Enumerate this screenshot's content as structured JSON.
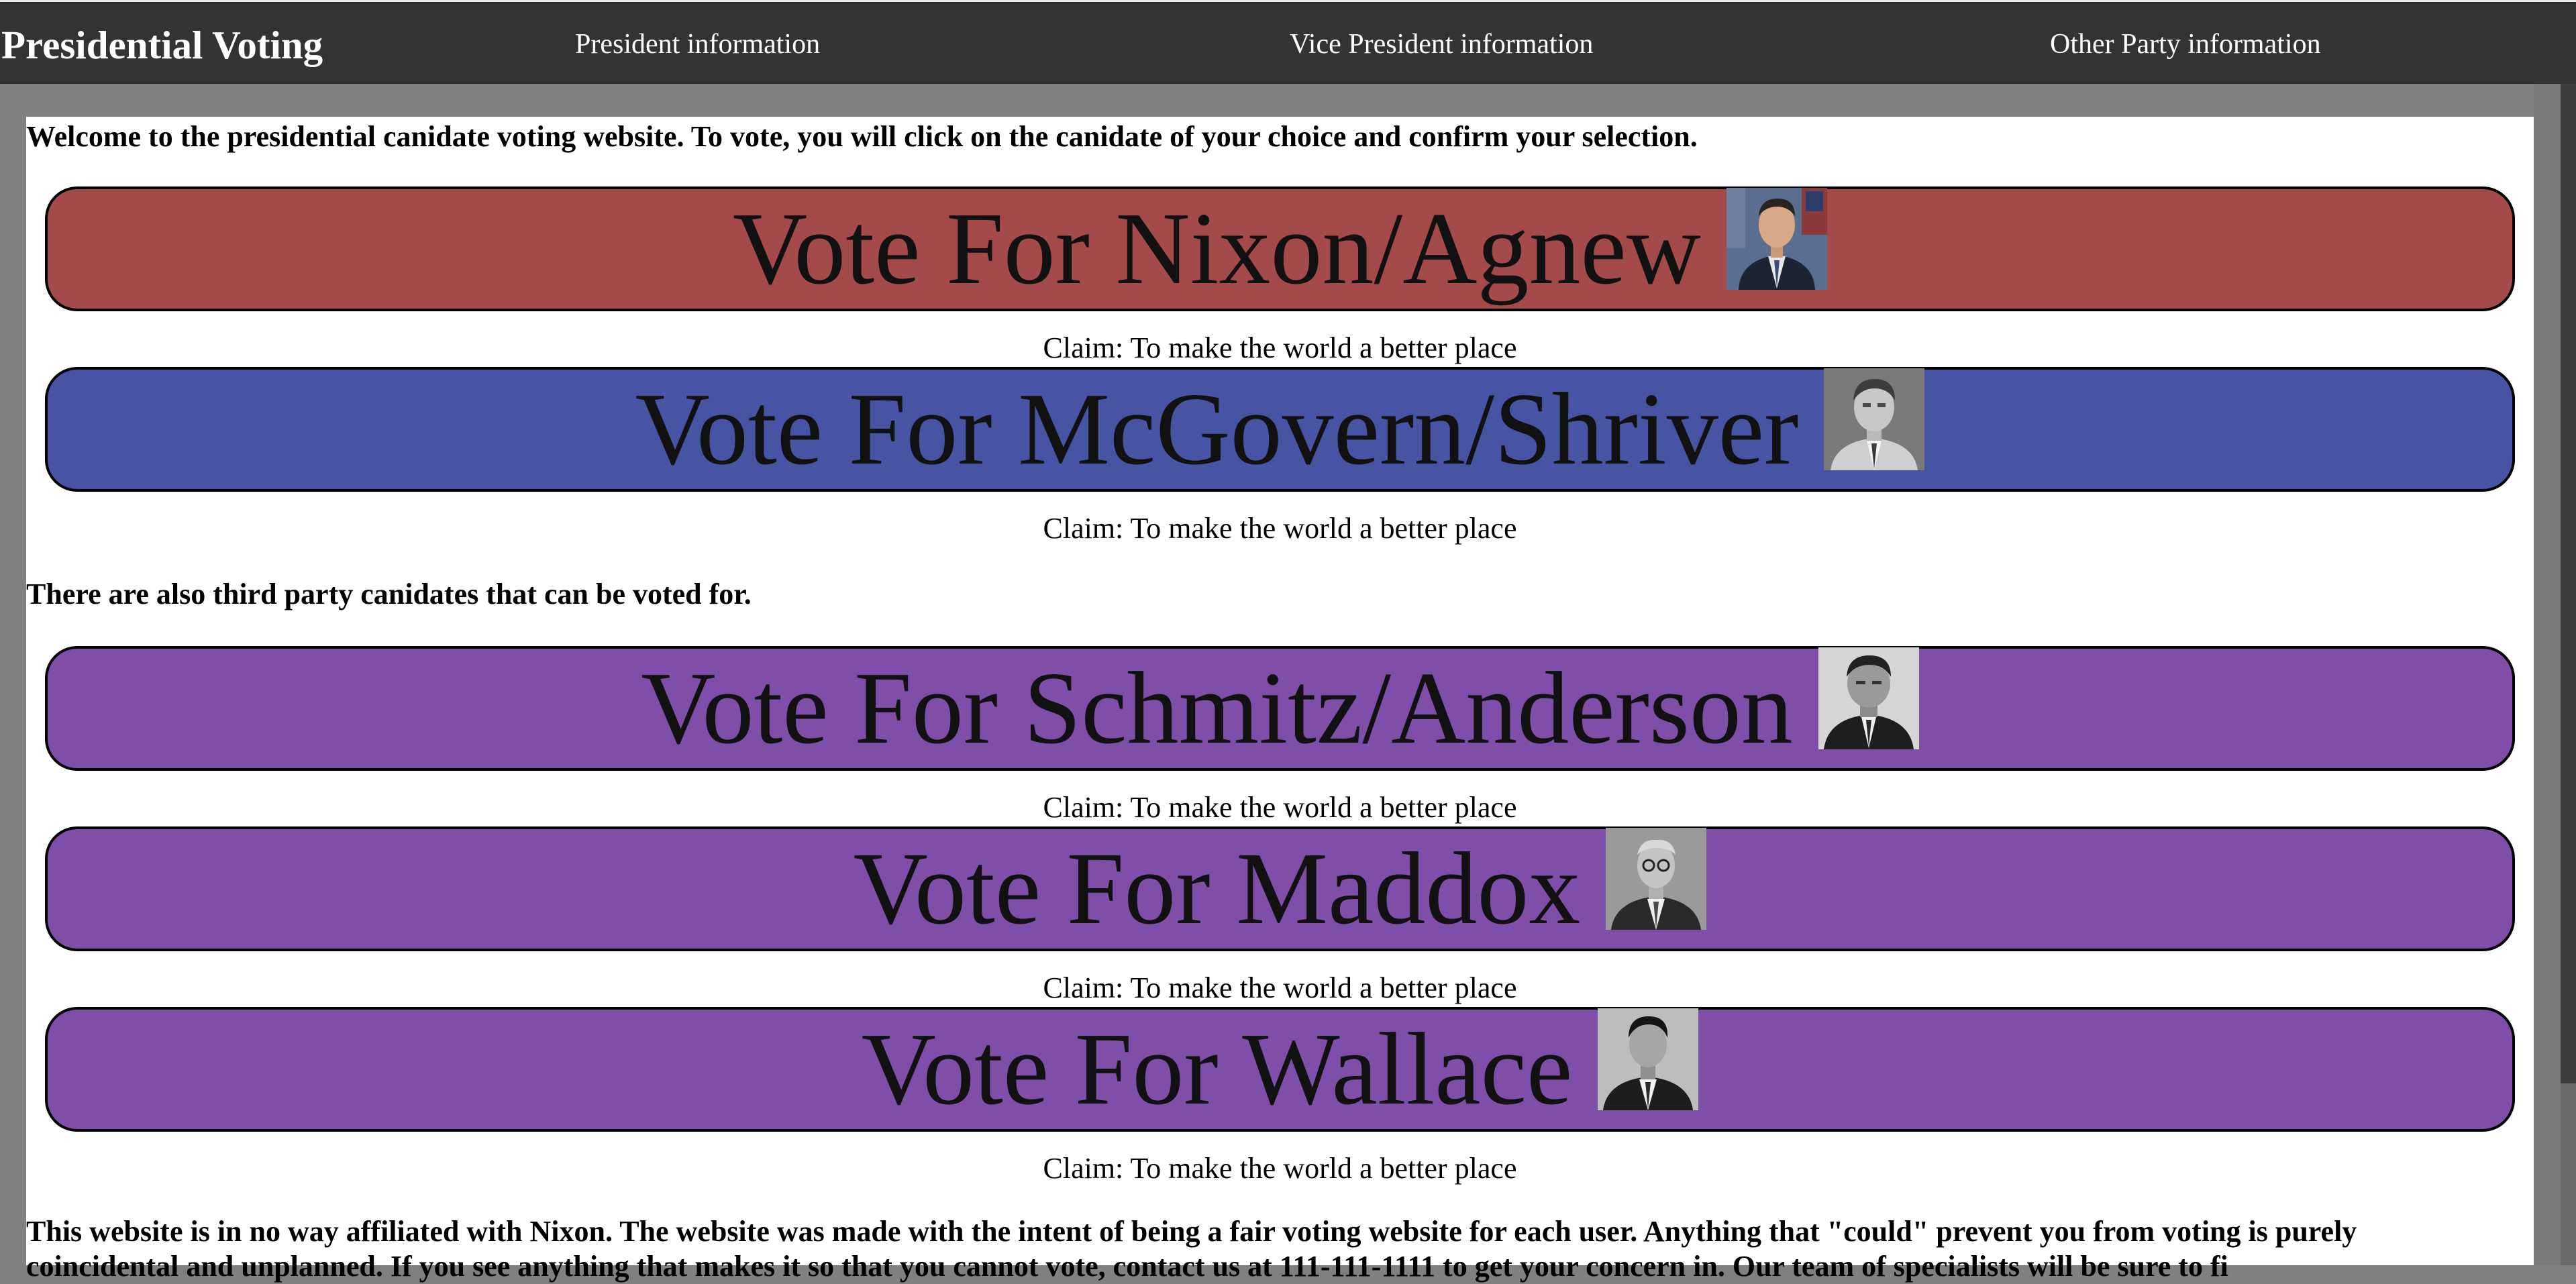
{
  "nav": {
    "title": "Presidential Voting",
    "links": [
      "President information",
      "Vice President information",
      "Other Party information"
    ]
  },
  "content": {
    "welcome": "Welcome to the presidential canidate voting website. To vote, you will click on the canidate of your choice and confirm your selection.",
    "third_party_intro": "There are also third party canidates that can be voted for.",
    "disclaimer_line1": "This website is in no way affiliated with Nixon. The website was made with the intent of being a fair voting website for each user. Anything that \"could\" prevent you from voting is purely",
    "disclaimer_line2": "coincidental and unplanned. If you see anything that makes it so that you cannot vote, contact us at 111-111-1111 to get your concern in. Our team of specialists will be sure to fi"
  },
  "candidates": [
    {
      "label": "Vote For Nixon/Agnew",
      "claim": "Claim: To make the world a better place",
      "color": "#a54a4a"
    },
    {
      "label": "Vote For McGovern/Shriver",
      "claim": "Claim: To make the world a better place",
      "color": "#4753a3"
    },
    {
      "label": "Vote For Schmitz/Anderson",
      "claim": "Claim: To make the world a better place",
      "color": "#7f4ea8"
    },
    {
      "label": "Vote For Maddox",
      "claim": "Claim: To make the world a better place",
      "color": "#7f4ea8"
    },
    {
      "label": "Vote For Wallace",
      "claim": "Claim: To make the world a better place",
      "color": "#7f4ea8"
    }
  ],
  "colors": {
    "nav_bg": "#333333",
    "page_bg": "#808080",
    "content_bg": "#ffffff"
  },
  "icons": [
    "nixon-portrait",
    "mcgovern-portrait",
    "schmitz-portrait",
    "maddox-portrait",
    "wallace-portrait"
  ]
}
